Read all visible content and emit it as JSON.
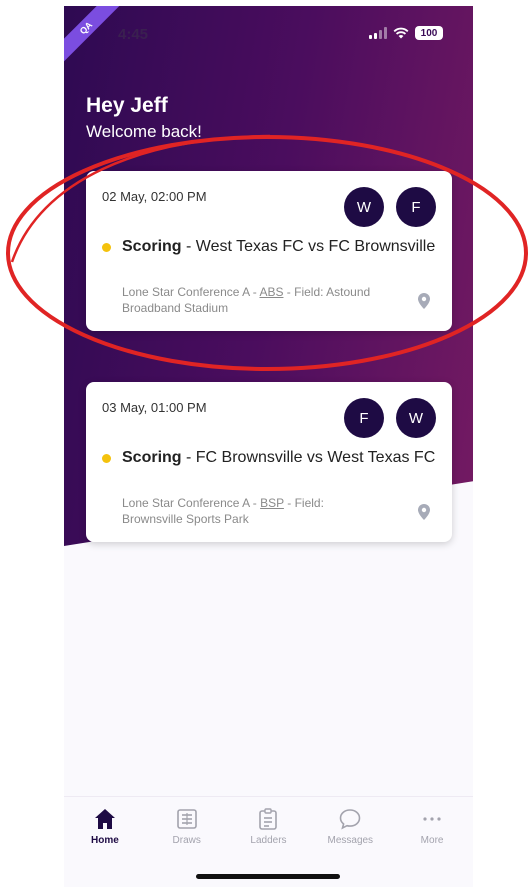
{
  "status_bar": {
    "time": "4:45",
    "battery": "100",
    "env_badge": "QA"
  },
  "greeting": {
    "name": "Hey Jeff",
    "subtitle": "Welcome back!"
  },
  "matches": [
    {
      "datetime": "02 May, 02:00 PM",
      "badges": [
        "W",
        "F"
      ],
      "status": "Scoring",
      "separator": " - ",
      "teams": "West Texas FC vs FC Brownsville",
      "conference": "Lone Star Conference A",
      "venue_code": "ABS",
      "field_label": "Field:",
      "field": "Astound Broadband Stadium"
    },
    {
      "datetime": "03 May, 01:00 PM",
      "badges": [
        "F",
        "W"
      ],
      "status": "Scoring",
      "separator": " - ",
      "teams": "FC Brownsville vs West Texas FC",
      "conference": "Lone Star Conference A",
      "venue_code": "BSP",
      "field_label": "Field:",
      "field": "Brownsville Sports Park"
    }
  ],
  "tabs": [
    {
      "label": "Home",
      "icon": "home-icon",
      "active": true
    },
    {
      "label": "Draws",
      "icon": "draws-icon",
      "active": false
    },
    {
      "label": "Ladders",
      "icon": "ladders-icon",
      "active": false
    },
    {
      "label": "Messages",
      "icon": "messages-icon",
      "active": false
    },
    {
      "label": "More",
      "icon": "more-icon",
      "active": false
    }
  ],
  "colors": {
    "hero_start": "#2e0a52",
    "hero_end": "#741a62",
    "badge_bg": "#1e0b44",
    "status_dot": "#f4c20d",
    "annotation": "#e02424"
  }
}
